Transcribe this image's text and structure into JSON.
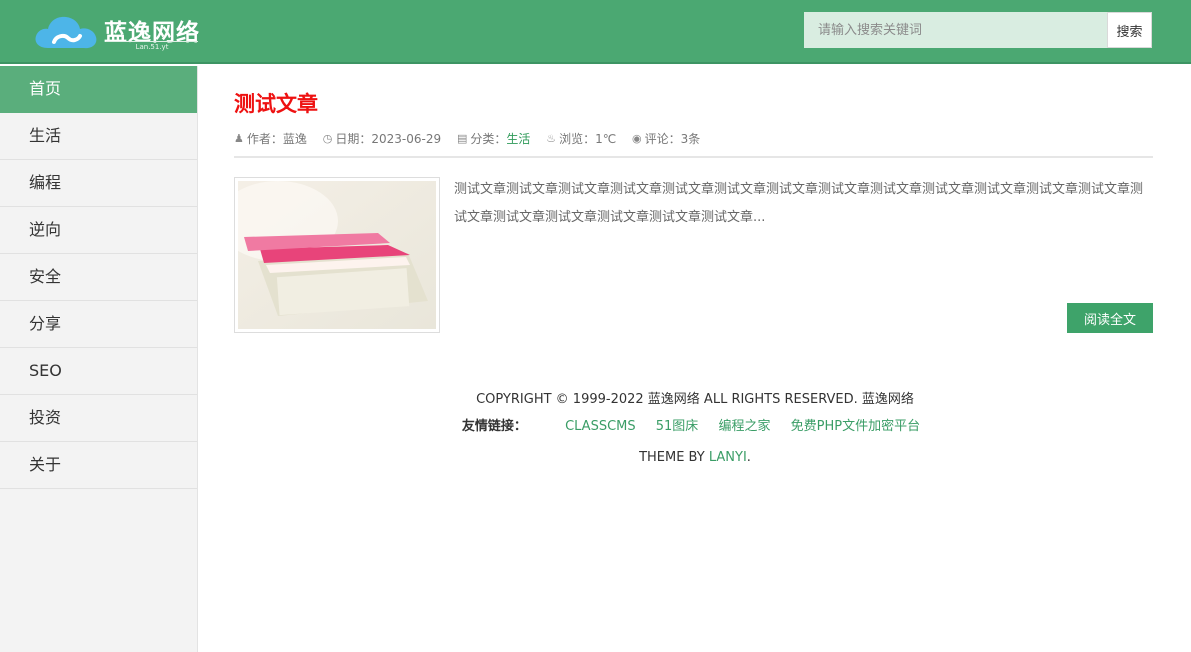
{
  "header": {
    "logo_text": "蓝逸网络",
    "logo_sub": "Lan.51.yt",
    "search_placeholder": "请输入搜索关键词",
    "search_button": "搜索"
  },
  "sidebar": {
    "items": [
      {
        "label": "首页",
        "active": true
      },
      {
        "label": "生活"
      },
      {
        "label": "编程"
      },
      {
        "label": "逆向"
      },
      {
        "label": "安全"
      },
      {
        "label": "分享"
      },
      {
        "label": "SEO"
      },
      {
        "label": "投资"
      },
      {
        "label": "关于"
      }
    ]
  },
  "article": {
    "title": "测试文章",
    "meta": {
      "author_label": "作者：",
      "author": "蓝逸",
      "date_label": "日期：",
      "date": "2023-06-29",
      "category_label": "分类：",
      "category": "生活",
      "views_label": "浏览：",
      "views": "1℃",
      "comments_label": "评论：",
      "comments": "3条"
    },
    "excerpt": "测试文章测试文章测试文章测试文章测试文章测试文章测试文章测试文章测试文章测试文章测试文章测试文章测试文章测试文章测试文章测试文章测试文章测试文章测试文章...",
    "read_more": "阅读全文"
  },
  "footer": {
    "copyright": "COPYRIGHT © 1999-2022 蓝逸网络 ALL RIGHTS RESERVED. 蓝逸网络",
    "links_label": "友情链接：",
    "links": [
      "CLASSCMS",
      "51图床",
      "编程之家",
      "免费PHP文件加密平台"
    ],
    "theme_prefix": "THEME BY ",
    "theme_author": "LANYI",
    "theme_suffix": "."
  },
  "colors": {
    "header_bg": "#4ba872",
    "accent": "#3ea36a",
    "title_red": "#ee1111",
    "nav_active": "#5aae7c"
  }
}
